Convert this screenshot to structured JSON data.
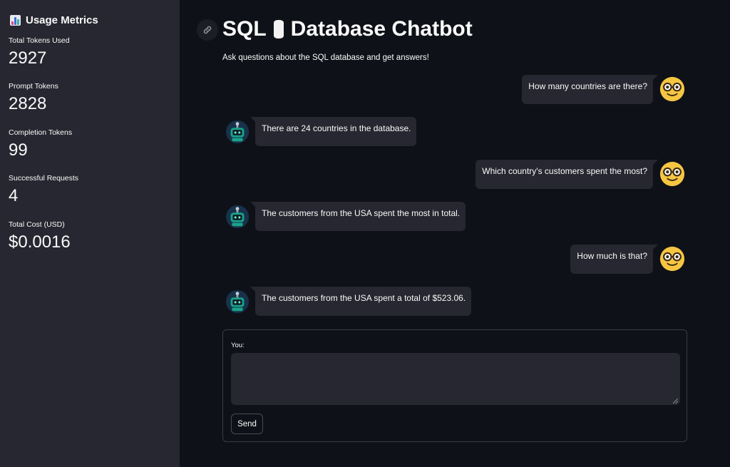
{
  "sidebar": {
    "title": "Usage Metrics",
    "icon": "bar-chart-icon",
    "metrics": [
      {
        "label": "Total Tokens Used",
        "value": "2927"
      },
      {
        "label": "Prompt Tokens",
        "value": "2828"
      },
      {
        "label": "Completion Tokens",
        "value": "99"
      },
      {
        "label": "Successful Requests",
        "value": "4"
      },
      {
        "label": "Total Cost (USD)",
        "value": "$0.0016"
      }
    ]
  },
  "header": {
    "title_prefix": "SQL",
    "title_suffix": "Database Chatbot",
    "title_icon": "database-icon",
    "subtitle": "Ask questions about the SQL database and get answers!",
    "anchor_icon": "link-icon"
  },
  "chat": {
    "messages": [
      {
        "role": "user",
        "text": "How many countries are there?"
      },
      {
        "role": "bot",
        "text": "There are 24 countries in the database."
      },
      {
        "role": "user",
        "text": "Which country's customers spent the most?"
      },
      {
        "role": "bot",
        "text": "The customers from the USA spent the most in total."
      },
      {
        "role": "user",
        "text": "How much is that?"
      },
      {
        "role": "bot",
        "text": "The customers from the USA spent a total of $523.06."
      }
    ]
  },
  "input": {
    "label": "You:",
    "value": "",
    "send_label": "Send"
  },
  "colors": {
    "background": "#0e1117",
    "sidebar": "#262730",
    "bubble": "#262730",
    "user_avatar": "#f6c642",
    "bot_avatar": "#1aa38a"
  }
}
